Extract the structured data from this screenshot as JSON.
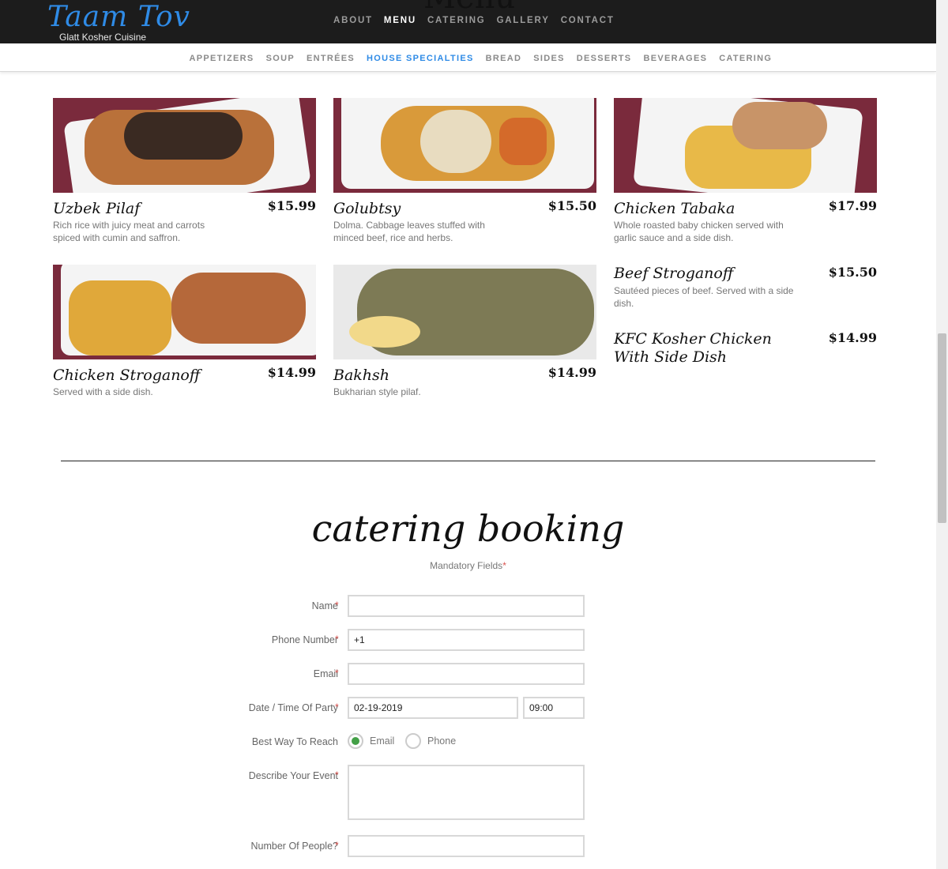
{
  "brand": {
    "name": "Taam Tov",
    "tagline": "Glatt Kosher Cuisine",
    "accent": "#2f8be6"
  },
  "page_heading": "Menu",
  "topnav": [
    {
      "label": "ABOUT",
      "active": false
    },
    {
      "label": "MENU",
      "active": true
    },
    {
      "label": "CATERING",
      "active": false
    },
    {
      "label": "GALLERY",
      "active": false
    },
    {
      "label": "CONTACT",
      "active": false
    }
  ],
  "subnav": [
    {
      "label": "APPETIZERS",
      "active": false
    },
    {
      "label": "SOUP",
      "active": false
    },
    {
      "label": "ENTRÉES",
      "active": false
    },
    {
      "label": "HOUSE SPECIALTIES",
      "active": true
    },
    {
      "label": "BREAD",
      "active": false
    },
    {
      "label": "SIDES",
      "active": false
    },
    {
      "label": "DESSERTS",
      "active": false
    },
    {
      "label": "BEVERAGES",
      "active": false
    },
    {
      "label": "CATERING",
      "active": false
    }
  ],
  "menu_items": [
    {
      "name": "Uzbek Pilaf",
      "price": "$15.99",
      "desc": "Rich rice with juicy meat and carrots spiced with cumin and saffron."
    },
    {
      "name": "Golubtsy",
      "price": "$15.50",
      "desc": "Dolma. Cabbage leaves stuffed with minced beef, rice and herbs."
    },
    {
      "name": "Chicken Tabaka",
      "price": "$17.99",
      "desc": "Whole roasted baby chicken served with garlic sauce and a side dish."
    },
    {
      "name": "Chicken Stroganoff",
      "price": "$14.99",
      "desc": "Served with a side dish."
    },
    {
      "name": "Bakhsh",
      "price": "$14.99",
      "desc": "Bukharian style pilaf."
    },
    {
      "name": "Beef Stroganoff",
      "price": "$15.50",
      "desc": "Sautéed pieces of beef. Served with a side dish."
    },
    {
      "name": "KFC Kosher Chicken With Side Dish",
      "price": "$14.99",
      "desc": ""
    }
  ],
  "form": {
    "title": "catering booking",
    "mandatory_note": "Mandatory Fields",
    "required_mark": "*",
    "name_label": "Name",
    "name_value": "",
    "phone_label": "Phone Number",
    "phone_value": "+1",
    "email_label": "Email",
    "email_value": "",
    "date_label": "Date / Time Of Party",
    "date_value": "02-19-2019",
    "time_value": "09:00",
    "reach_label": "Best Way To Reach",
    "reach_options": [
      "Email",
      "Phone"
    ],
    "reach_selected": "Email",
    "event_label": "Describe Your Event",
    "event_value": "",
    "people_label": "Number Of People?",
    "people_value": ""
  }
}
